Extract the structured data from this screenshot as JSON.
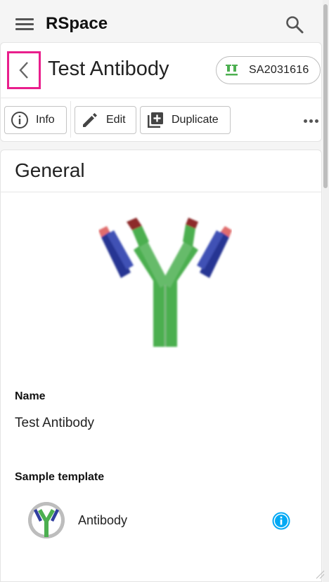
{
  "app": {
    "title": "RSpace",
    "icons": {
      "menu": "menu-icon",
      "search": "search-icon"
    }
  },
  "record": {
    "title": "Test Antibody",
    "global_id": "SA2031616",
    "global_id_icon": "sample-icon",
    "global_id_icon_color": "#4caf50",
    "back_icon": "chevron-left-icon",
    "highlight_color": "#e91e8c"
  },
  "toolbar": {
    "info_label": "Info",
    "edit_label": "Edit",
    "duplicate_label": "Duplicate",
    "more_icon": "more-horizontal-icon"
  },
  "general": {
    "section_title": "General",
    "image_icon": "antibody-image",
    "name_label": "Name",
    "name_value": "Test Antibody",
    "template_label": "Sample template",
    "template_name": "Antibody",
    "template_info_color": "#03a9f4"
  }
}
